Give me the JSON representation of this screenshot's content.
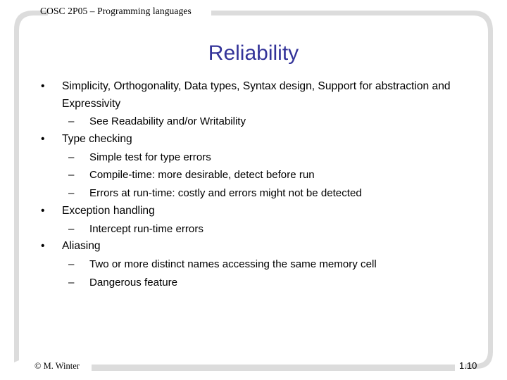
{
  "slide": {
    "header": "COSC 2P05 – Programming languages",
    "title": "Reliability",
    "bullets": [
      {
        "level": 1,
        "marker": "•",
        "text": "Simplicity, Orthogonality, Data types, Syntax design, Support for abstraction and Expressivity"
      },
      {
        "level": 2,
        "marker": "–",
        "text": "See Readability and/or Writability"
      },
      {
        "level": 1,
        "marker": "•",
        "text": "Type checking"
      },
      {
        "level": 2,
        "marker": "–",
        "text": "Simple test for type errors"
      },
      {
        "level": 2,
        "marker": "–",
        "text": "Compile-time: more desirable, detect before run"
      },
      {
        "level": 2,
        "marker": "–",
        "text": "Errors at run-time: costly and errors might not be detected"
      },
      {
        "level": 1,
        "marker": "•",
        "text": "Exception handling"
      },
      {
        "level": 2,
        "marker": "–",
        "text": "Intercept run-time errors"
      },
      {
        "level": 1,
        "marker": "•",
        "text": "Aliasing"
      },
      {
        "level": 2,
        "marker": "–",
        "text": "Two or more distinct names accessing the same memory cell"
      },
      {
        "level": 2,
        "marker": "–",
        "text": "Dangerous feature"
      }
    ],
    "footer": {
      "copyright": "© M. Winter",
      "page_number": "1.10"
    },
    "colors": {
      "title": "#333399",
      "body_text": "#000000",
      "frame_gray": "#dcdcdc",
      "background": "#ffffff"
    }
  }
}
